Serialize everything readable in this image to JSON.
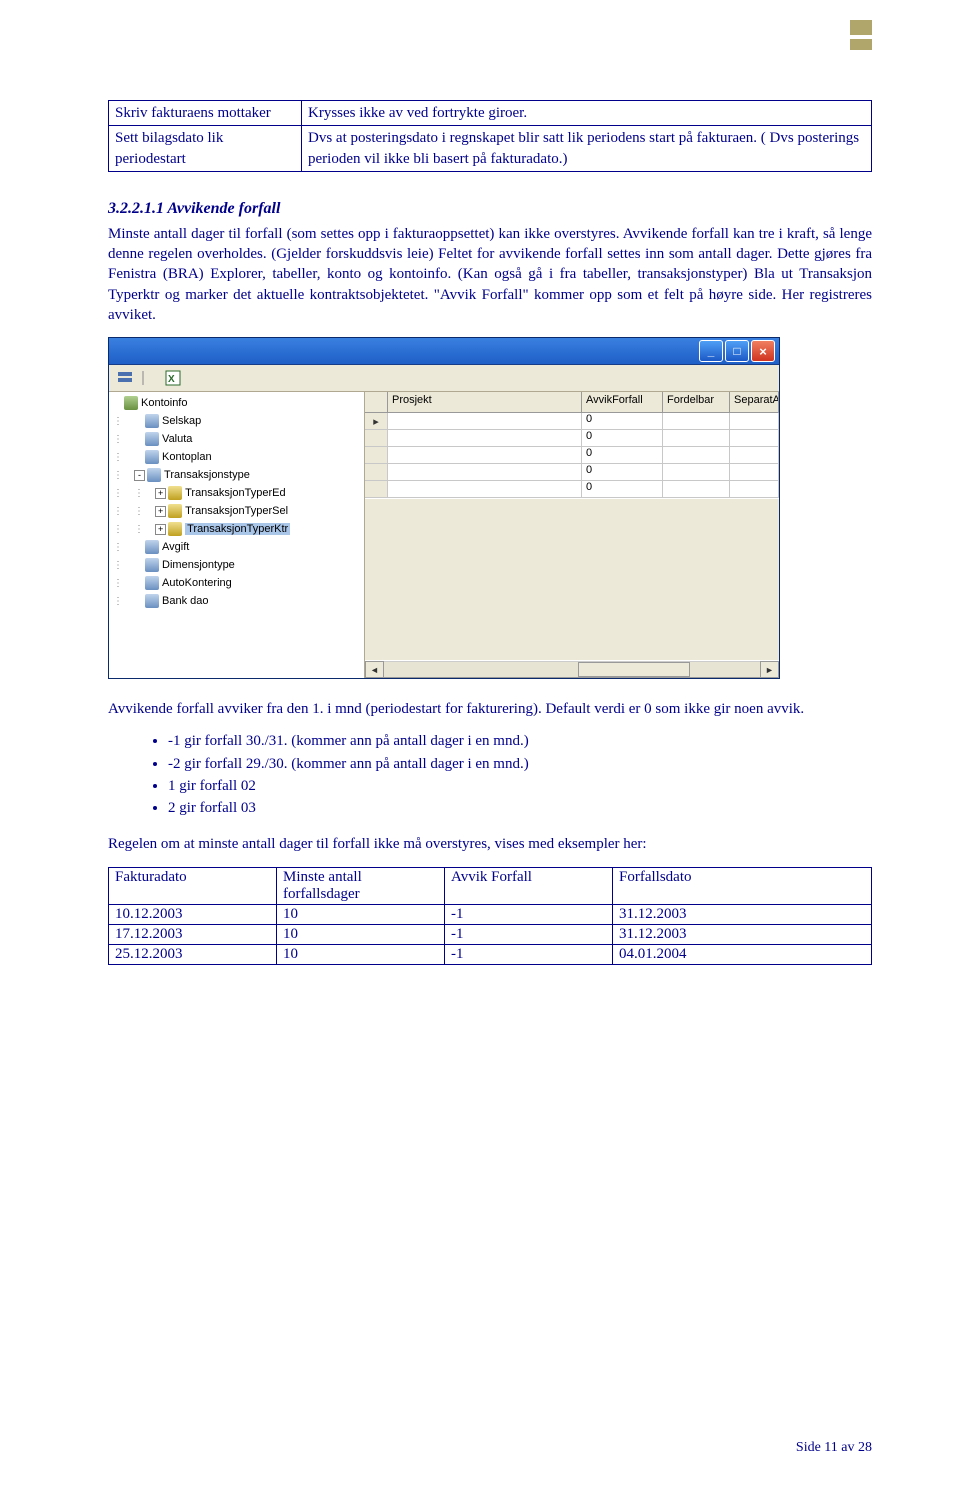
{
  "box_table": {
    "r1c1": "Skriv fakturaens mottaker",
    "r1c2": "Krysses ikke av ved fortrykte giroer.",
    "r2c1": "Sett bilagsdato lik periodestart",
    "r2c2": "Dvs at posteringsdato i regnskapet blir satt lik periodens start på fakturaen. ( Dvs posterings perioden vil ikke bli basert på fakturadato.)"
  },
  "section_heading": "3.2.2.1.1    Avvikende forfall",
  "para1": "Minste antall dager til forfall (som settes opp i fakturaoppsettet) kan ikke overstyres. Avvikende forfall kan tre i kraft, så lenge denne regelen overholdes. (Gjelder forskuddsvis leie) Feltet for avvikende forfall settes inn som antall dager. Dette gjøres fra  Fenistra (BRA) Explorer, tabeller, konto og kontoinfo. (Kan også gå i fra tabeller, transaksjonstyper) Bla ut Transaksjon Typerktr og marker det aktuelle kontraktsobjektetet. \"Avvik Forfall\" kommer opp som et felt på høyre side. Her registreres avviket.",
  "ss": {
    "tree": [
      {
        "lvl": 0,
        "pm": "",
        "ico": "g",
        "txt": "Kontoinfo"
      },
      {
        "lvl": 1,
        "pm": "",
        "ico": "b",
        "txt": "Selskap"
      },
      {
        "lvl": 1,
        "pm": "",
        "ico": "b",
        "txt": "Valuta"
      },
      {
        "lvl": 1,
        "pm": "",
        "ico": "b",
        "txt": "Kontoplan"
      },
      {
        "lvl": 1,
        "pm": "-",
        "ico": "b",
        "txt": "Transaksjonstype"
      },
      {
        "lvl": 2,
        "pm": "+",
        "ico": "y",
        "txt": "TransaksjonTyperEd"
      },
      {
        "lvl": 2,
        "pm": "+",
        "ico": "y",
        "txt": "TransaksjonTyperSel"
      },
      {
        "lvl": 2,
        "pm": "+",
        "ico": "y",
        "txt": "TransaksjonTyperKtr",
        "sel": true
      },
      {
        "lvl": 1,
        "pm": "",
        "ico": "b",
        "txt": "Avgift"
      },
      {
        "lvl": 1,
        "pm": "",
        "ico": "b",
        "txt": "Dimensjontype"
      },
      {
        "lvl": 1,
        "pm": "",
        "ico": "b",
        "txt": "AutoKontering"
      },
      {
        "lvl": 1,
        "pm": "",
        "ico": "b",
        "txt": "Bank dao"
      }
    ],
    "cols": {
      "c1": "Prosjekt",
      "c2": "AvvikForfall",
      "c3": "Fordelbar",
      "c4": "SeparatAvr"
    },
    "rows": [
      {
        "p": "",
        "a": "0",
        "f": "",
        "s": ""
      },
      {
        "p": "",
        "a": "0",
        "f": "",
        "s": ""
      },
      {
        "p": "",
        "a": "0",
        "f": "",
        "s": ""
      },
      {
        "p": "",
        "a": "0",
        "f": "",
        "s": ""
      },
      {
        "p": "",
        "a": "0",
        "f": "",
        "s": ""
      }
    ]
  },
  "para2": "Avvikende forfall avviker fra den 1. i mnd (periodestart for fakturering). Default verdi er 0 som ikke gir noen avvik.",
  "bullets": [
    "-1 gir forfall 30./31. (kommer ann på antall dager i en mnd.)",
    "-2 gir forfall 29./30. (kommer ann på antall dager i en mnd.)",
    "1 gir forfall 02",
    "2 gir forfall 03"
  ],
  "para3": "Regelen om at minste antall dager til forfall ikke må overstyres,  vises med eksempler her:",
  "ex": {
    "h1": "Fakturadato",
    "h2": "Minste antall forfallsdager",
    "h3": "Avvik Forfall",
    "h4": "Forfallsdato",
    "rows": [
      {
        "a": "10.12.2003",
        "b": "10",
        "c": "-1",
        "d": "31.12.2003"
      },
      {
        "a": "17.12.2003",
        "b": "10",
        "c": "-1",
        "d": "31.12.2003"
      },
      {
        "a": "25.12.2003",
        "b": "10",
        "c": "-1",
        "d": "04.01.2004"
      }
    ]
  },
  "footer": "Side 11 av 28"
}
